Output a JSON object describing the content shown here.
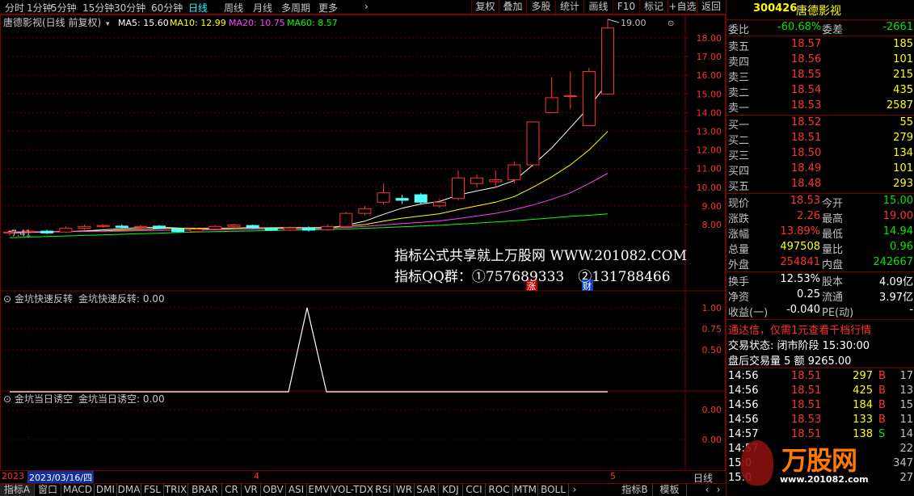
{
  "toolbar": {
    "periods": [
      "分时",
      "1分钟",
      "5分钟",
      "15分钟",
      "30分钟",
      "60分钟",
      "日线",
      "周线",
      "月线",
      "多周期",
      "更多"
    ],
    "active_period": "日线",
    "more_arrow": "›",
    "buttons": [
      "复权",
      "叠加",
      "多股",
      "统计",
      "画线",
      "F10",
      "标记",
      "+自选",
      "返回"
    ]
  },
  "main_chart": {
    "title": "唐德影视(日线 前复权)",
    "ma": [
      {
        "label": "MA5: 15.60",
        "color": "#ffffff"
      },
      {
        "label": "MA10: 12.99",
        "color": "#ffff00"
      },
      {
        "label": "MA20: 10.75",
        "color": "#ff40ff"
      },
      {
        "label": "MA60: 8.57",
        "color": "#00ff00"
      }
    ],
    "yaxis": [
      "18.00",
      "17.00",
      "16.00",
      "15.00",
      "14.00",
      "13.00",
      "12.00",
      "11.00",
      "10.00",
      "9.00",
      "8.00"
    ],
    "high_label": "19.00",
    "low_label": "7.41",
    "badge_zhang": "涨",
    "badge_cai": "财",
    "watermark_line1": "指标公式共享就上万股网 WWW.201082.COM",
    "watermark_line2": "指标QQ群：①757689333　②131788466"
  },
  "sub1": {
    "title": "金坑快速反转",
    "value_label": "金坑快速反转: 0.00",
    "yaxis": [
      "1.00",
      "0.75",
      "0.50"
    ]
  },
  "sub2": {
    "title": "金坑当日诱空",
    "value_label": "金坑当日诱空: 0.00",
    "yaxis": [
      "0.00",
      "0.00"
    ]
  },
  "datebar": {
    "year": "2023",
    "cursor_date": "2023/03/16/四",
    "month4": "4",
    "month5": "5",
    "period": "日线"
  },
  "bottom_tabs": [
    "指标A",
    "窗口",
    "MACD",
    "DMI",
    "DMA",
    "FSL",
    "TRIX",
    "BRAR",
    "CR",
    "VR",
    "OBV",
    "ASI",
    "EMV",
    "VOL-TDX",
    "RSI",
    "WR",
    "SAR",
    "KDJ",
    "CCI",
    "ROC",
    "MTM",
    "BOLL"
  ],
  "bottom_right": [
    "指标B",
    "模板"
  ],
  "quote": {
    "code": "300426",
    "name": "唐德影视",
    "weibi_label": "委比",
    "weibi_value": "-60.68%",
    "weicha_label": "委差",
    "weicha_value": "-2661",
    "asks": [
      {
        "label": "卖五",
        "price": "18.57",
        "vol": "185"
      },
      {
        "label": "卖四",
        "price": "18.56",
        "vol": "101"
      },
      {
        "label": "卖三",
        "price": "18.55",
        "vol": "215"
      },
      {
        "label": "卖二",
        "price": "18.54",
        "vol": "435"
      },
      {
        "label": "卖一",
        "price": "18.53",
        "vol": "2587"
      }
    ],
    "bids": [
      {
        "label": "买一",
        "price": "18.52",
        "vol": "55"
      },
      {
        "label": "买二",
        "price": "18.51",
        "vol": "279"
      },
      {
        "label": "买三",
        "price": "18.50",
        "vol": "134"
      },
      {
        "label": "买四",
        "price": "18.49",
        "vol": "101"
      },
      {
        "label": "买五",
        "price": "18.48",
        "vol": "293"
      }
    ],
    "stats": [
      {
        "l1": "现价",
        "v1": "18.53",
        "c1": "red",
        "l2": "今开",
        "v2": "15.00",
        "c2": "green"
      },
      {
        "l1": "涨跌",
        "v1": "2.26",
        "c1": "red",
        "l2": "最高",
        "v2": "19.00",
        "c2": "red"
      },
      {
        "l1": "涨幅",
        "v1": "13.89%",
        "c1": "red",
        "l2": "最低",
        "v2": "14.94",
        "c2": "green"
      },
      {
        "l1": "总量",
        "v1": "497508",
        "c1": "yellow",
        "l2": "量比",
        "v2": "0.96",
        "c2": "green"
      },
      {
        "l1": "外盘",
        "v1": "254841",
        "c1": "red",
        "l2": "内盘",
        "v2": "242667",
        "c2": "green"
      }
    ],
    "stats2": [
      {
        "l1": "换手",
        "v1": "12.53%",
        "l2": "股本",
        "v2": "4.09亿"
      },
      {
        "l1": "净资",
        "v1": "0.25",
        "l2": "流通",
        "v2": "3.97亿"
      },
      {
        "l1": "收益(一)",
        "v1": "-0.040",
        "l2": "PE(动)",
        "v2": "-"
      }
    ],
    "promo": "通达信，仅需1元查看千档行情",
    "status_label": "交易状态: 闭市阶段 15:30:00",
    "after_hours": "盘后交易量 5 额 9265.00",
    "ticks": [
      {
        "time": "14:56",
        "price": "18.51",
        "vol": "297",
        "dir": "B",
        "n": "17"
      },
      {
        "time": "14:56",
        "price": "18.51",
        "vol": "425",
        "dir": "B",
        "n": "13"
      },
      {
        "time": "14:56",
        "price": "18.51",
        "vol": "184",
        "dir": "B",
        "n": "15"
      },
      {
        "time": "14:56",
        "price": "18.53",
        "vol": "133",
        "dir": "B",
        "n": "11"
      },
      {
        "time": "14:57",
        "price": "18.51",
        "vol": "138",
        "dir": "S",
        "n": "14"
      },
      {
        "time": "14:57",
        "price": "",
        "vol": "",
        "dir": "",
        "n": "22"
      },
      {
        "time": "15:0",
        "price": "",
        "vol": "",
        "dir": "",
        "n": "347"
      },
      {
        "time": "15:0",
        "price": "",
        "vol": "",
        "dir": "",
        "n": "27"
      }
    ],
    "logo_text": "万股网",
    "logo_url": "www.201082.com"
  },
  "chart_data": {
    "type": "candlestick",
    "title": "唐德影视(日线 前复权)",
    "ylim": [
      7.2,
      19.6
    ],
    "candles": [
      {
        "o": 7.55,
        "c": 7.6,
        "h": 7.7,
        "l": 7.4
      },
      {
        "o": 7.6,
        "c": 7.65,
        "h": 7.75,
        "l": 7.5
      },
      {
        "o": 7.65,
        "c": 7.55,
        "h": 7.72,
        "l": 7.48
      },
      {
        "o": 7.6,
        "c": 7.8,
        "h": 7.9,
        "l": 7.55
      },
      {
        "o": 7.8,
        "c": 7.9,
        "h": 8.0,
        "l": 7.72
      },
      {
        "o": 7.9,
        "c": 7.95,
        "h": 8.02,
        "l": 7.82
      },
      {
        "o": 7.92,
        "c": 7.85,
        "h": 8.0,
        "l": 7.8
      },
      {
        "o": 7.85,
        "c": 7.9,
        "h": 7.98,
        "l": 7.78
      },
      {
        "o": 7.92,
        "c": 7.8,
        "h": 7.98,
        "l": 7.75
      },
      {
        "o": 7.78,
        "c": 7.62,
        "h": 7.84,
        "l": 7.58
      },
      {
        "o": 7.62,
        "c": 7.75,
        "h": 7.82,
        "l": 7.58
      },
      {
        "o": 7.75,
        "c": 7.9,
        "h": 7.96,
        "l": 7.7
      },
      {
        "o": 7.9,
        "c": 7.98,
        "h": 8.05,
        "l": 7.85
      },
      {
        "o": 7.95,
        "c": 7.82,
        "h": 8.0,
        "l": 7.78
      },
      {
        "o": 7.8,
        "c": 7.7,
        "h": 7.86,
        "l": 7.65
      },
      {
        "o": 7.7,
        "c": 7.82,
        "h": 7.9,
        "l": 7.66
      },
      {
        "o": 7.82,
        "c": 7.7,
        "h": 7.9,
        "l": 7.62
      },
      {
        "o": 7.72,
        "c": 7.9,
        "h": 8.0,
        "l": 7.66
      },
      {
        "o": 7.9,
        "c": 8.6,
        "h": 8.68,
        "l": 7.86
      },
      {
        "o": 8.6,
        "c": 8.85,
        "h": 9.0,
        "l": 8.5
      },
      {
        "o": 9.2,
        "c": 9.7,
        "h": 10.2,
        "l": 9.1
      },
      {
        "o": 9.4,
        "c": 9.3,
        "h": 9.6,
        "l": 9.1
      },
      {
        "o": 9.6,
        "c": 9.2,
        "h": 9.7,
        "l": 9.1
      },
      {
        "o": 9.0,
        "c": 9.2,
        "h": 9.4,
        "l": 8.9
      },
      {
        "o": 9.4,
        "c": 10.5,
        "h": 10.9,
        "l": 9.3
      },
      {
        "o": 10.2,
        "c": 10.5,
        "h": 10.7,
        "l": 10.0
      },
      {
        "o": 10.3,
        "c": 10.4,
        "h": 10.9,
        "l": 10.0
      },
      {
        "o": 10.4,
        "c": 11.2,
        "h": 11.4,
        "l": 10.2
      },
      {
        "o": 11.2,
        "c": 13.5,
        "h": 13.5,
        "l": 11.1
      },
      {
        "o": 14.0,
        "c": 14.8,
        "h": 15.9,
        "l": 14.0
      },
      {
        "o": 14.9,
        "c": 14.9,
        "h": 16.2,
        "l": 14.2
      },
      {
        "o": 13.3,
        "c": 16.2,
        "h": 16.4,
        "l": 13.3
      },
      {
        "o": 15.0,
        "c": 18.53,
        "h": 19.0,
        "l": 14.94
      }
    ],
    "ma5": [
      7.55,
      7.58,
      7.6,
      7.62,
      7.66,
      7.72,
      7.78,
      7.84,
      7.86,
      7.82,
      7.78,
      7.78,
      7.8,
      7.84,
      7.82,
      7.8,
      7.78,
      7.8,
      7.96,
      8.18,
      8.55,
      8.88,
      9.1,
      9.24,
      9.58,
      9.8,
      10.0,
      10.36,
      11.2,
      12.1,
      13.2,
      14.3,
      15.6
    ],
    "ma10": [
      7.6,
      7.61,
      7.62,
      7.63,
      7.64,
      7.66,
      7.7,
      7.74,
      7.78,
      7.8,
      7.8,
      7.8,
      7.81,
      7.82,
      7.83,
      7.84,
      7.84,
      7.85,
      7.92,
      8.0,
      8.18,
      8.34,
      8.46,
      8.58,
      8.8,
      9.0,
      9.2,
      9.5,
      10.0,
      10.55,
      11.2,
      12.0,
      12.99
    ],
    "ma20": [
      7.6,
      7.61,
      7.61,
      7.62,
      7.63,
      7.64,
      7.65,
      7.67,
      7.69,
      7.7,
      7.71,
      7.72,
      7.73,
      7.75,
      7.77,
      7.79,
      7.8,
      7.81,
      7.85,
      7.9,
      7.98,
      8.05,
      8.12,
      8.2,
      8.32,
      8.46,
      8.6,
      8.8,
      9.05,
      9.35,
      9.7,
      10.2,
      10.75
    ],
    "ma60": [
      7.3,
      7.33,
      7.36,
      7.39,
      7.42,
      7.45,
      7.48,
      7.51,
      7.54,
      7.57,
      7.6,
      7.62,
      7.64,
      7.66,
      7.68,
      7.7,
      7.72,
      7.74,
      7.76,
      7.8,
      7.84,
      7.88,
      7.92,
      7.96,
      8.02,
      8.08,
      8.14,
      8.2,
      8.28,
      8.36,
      8.44,
      8.5,
      8.57
    ],
    "indicator1": {
      "name": "金坑快速反转",
      "ylim": [
        0,
        1.1
      ],
      "spike_index": 20,
      "spike_value": 1.0
    },
    "indicator2": {
      "name": "金坑当日诱空",
      "value": 0.0
    }
  },
  "colors": {
    "up": "#ff3232",
    "down": "#54ffff",
    "frame": "#800000",
    "grid": "#800000"
  }
}
